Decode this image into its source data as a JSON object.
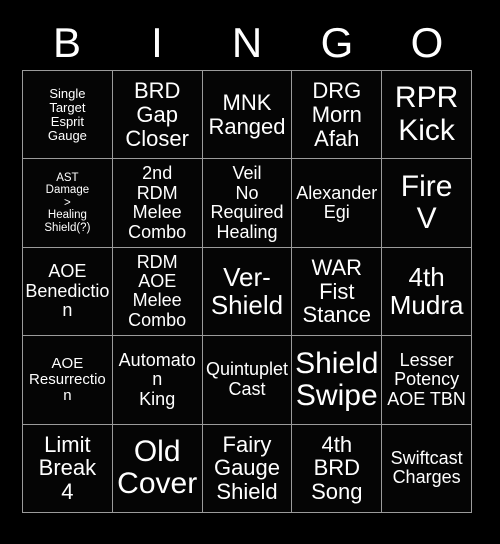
{
  "card": {
    "title": "BINGO",
    "background_color": "#000000",
    "text_color": "#ffffff",
    "border_color": "#9b9b9b",
    "header": {
      "letters": [
        "B",
        "I",
        "N",
        "G",
        "O"
      ]
    },
    "grid": {
      "columns": 5,
      "rows": 5,
      "cells": [
        {
          "text": "Single\nTarget\nEsprit\nGauge",
          "size": "xs"
        },
        {
          "text": "BRD\nGap\nCloser",
          "size": "lg"
        },
        {
          "text": "MNK\nRanged",
          "size": "lg"
        },
        {
          "text": "DRG\nMorn\nAfah",
          "size": "lg"
        },
        {
          "text": "RPR\nKick",
          "size": "xxl"
        },
        {
          "text": "AST\nDamage\n>\nHealing\nShield(?)",
          "size": "xxs"
        },
        {
          "text": "2nd\nRDM\nMelee\nCombo",
          "size": "md"
        },
        {
          "text": "Veil\nNo\nRequired\nHealing",
          "size": "md"
        },
        {
          "text": "Alexander\nEgi",
          "size": "md"
        },
        {
          "text": "Fire\nV",
          "size": "xxl"
        },
        {
          "text": "AOE\nBenediction",
          "size": "md"
        },
        {
          "text": "RDM\nAOE\nMelee\nCombo",
          "size": "md"
        },
        {
          "text": "Ver-\nShield",
          "size": "xl"
        },
        {
          "text": "WAR\nFist\nStance",
          "size": "lg"
        },
        {
          "text": "4th\nMudra",
          "size": "xl"
        },
        {
          "text": "AOE\nResurrection",
          "size": "sm"
        },
        {
          "text": "Automaton\nKing",
          "size": "md"
        },
        {
          "text": "Quintuplet\nCast",
          "size": "md"
        },
        {
          "text": "Shield\nSwipe",
          "size": "xxl"
        },
        {
          "text": "Lesser\nPotency\nAOE TBN",
          "size": "md"
        },
        {
          "text": "Limit\nBreak\n4",
          "size": "lg"
        },
        {
          "text": "Old\nCover",
          "size": "xxl"
        },
        {
          "text": "Fairy\nGauge\nShield",
          "size": "lg"
        },
        {
          "text": "4th\nBRD\nSong",
          "size": "lg"
        },
        {
          "text": "Swiftcast\nCharges",
          "size": "md"
        }
      ]
    }
  }
}
